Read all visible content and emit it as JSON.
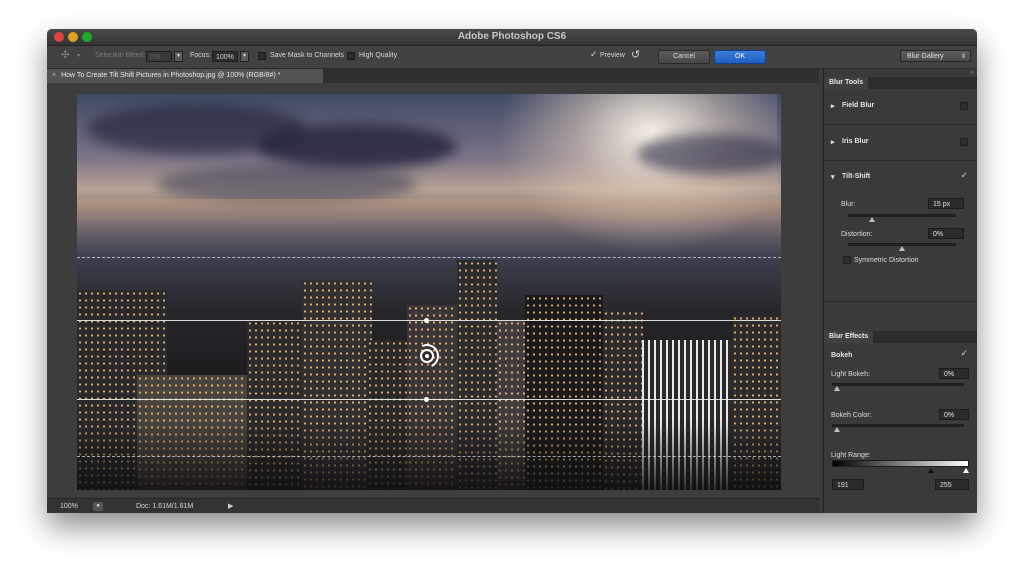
{
  "app": {
    "title": "Adobe Photoshop CS6"
  },
  "options_bar": {
    "selection_bleed_label": "Selection Bleed:",
    "selection_bleed_value": "0%",
    "focus_label": "Focus:",
    "focus_value": "100%",
    "save_mask_label": "Save Mask to Channels",
    "high_quality_label": "High Quality",
    "preview_label": "Preview",
    "preview_checked": true,
    "cancel_label": "Cancel",
    "ok_label": "OK",
    "workspace_dropdown": "Blur Gallery"
  },
  "document": {
    "tab_title": "How To Create Tilt Shift Pictures in Photoshop.jpg @ 100% (RGB/8#) *"
  },
  "status_bar": {
    "zoom": "100%",
    "doc_info": "Doc: 1.61M/1.61M"
  },
  "blur_tools": {
    "tab_label": "Blur Tools",
    "field_blur": {
      "label": "Field Blur",
      "enabled": false
    },
    "iris_blur": {
      "label": "Iris Blur",
      "enabled": false
    },
    "tilt_shift": {
      "label": "Tilt-Shift",
      "enabled": true,
      "blur_label": "Blur:",
      "blur_value": "15 px",
      "distortion_label": "Distortion:",
      "distortion_value": "0%",
      "symmetric_label": "Symmetric Distortion"
    }
  },
  "blur_effects": {
    "tab_label": "Blur Effects",
    "bokeh_label": "Bokeh",
    "bokeh_enabled": true,
    "light_bokeh_label": "Light Bokeh:",
    "light_bokeh_value": "0%",
    "bokeh_color_label": "Bokeh Color:",
    "bokeh_color_value": "0%",
    "light_range_label": "Light Range:",
    "light_range_low": "191",
    "light_range_high": "255"
  },
  "colors": {
    "accent_blue": "#1e5fc4",
    "panel_bg": "#3a3a3a"
  }
}
